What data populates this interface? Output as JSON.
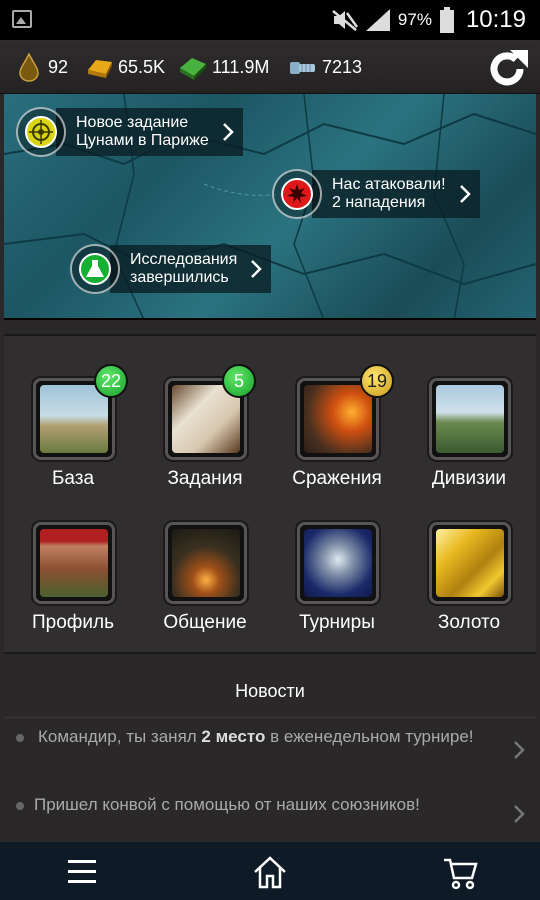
{
  "status_bar": {
    "battery": "97%",
    "time": "10:19"
  },
  "resources": [
    {
      "icon": "oil-drop-icon",
      "value": "92"
    },
    {
      "icon": "gold-bar-icon",
      "value": "65.5K"
    },
    {
      "icon": "money-stack-icon",
      "value": "111.9M"
    },
    {
      "icon": "bolt-icon",
      "value": "7213"
    }
  ],
  "notifications": [
    {
      "line1": "Новое задание",
      "line2": "Цунами в Париже",
      "icon": "target-icon",
      "color": "#d8d410"
    },
    {
      "line1": "Нас атаковали!",
      "line2": "2 нападения",
      "icon": "explosion-icon",
      "color": "#e01818"
    },
    {
      "line1": "Исследования",
      "line2": "завершились",
      "icon": "flask-icon",
      "color": "#18b030"
    }
  ],
  "menu": [
    {
      "label": "База",
      "badge": "22",
      "badge_color": "green",
      "icon": "base-icon"
    },
    {
      "label": "Задания",
      "badge": "5",
      "badge_color": "green",
      "icon": "missions-map-icon"
    },
    {
      "label": "Сражения",
      "badge": "19",
      "badge_color": "gold",
      "icon": "battle-tank-icon"
    },
    {
      "label": "Дивизии",
      "badge": "",
      "badge_color": "",
      "icon": "divisions-tanks-icon"
    },
    {
      "label": "Профиль",
      "badge": "",
      "badge_color": "",
      "icon": "soldier-portrait-icon"
    },
    {
      "label": "Общение",
      "badge": "",
      "badge_color": "",
      "icon": "campfire-icon"
    },
    {
      "label": "Турниры",
      "badge": "",
      "badge_color": "",
      "icon": "trophy-icon"
    },
    {
      "label": "Золото",
      "badge": "",
      "badge_color": "",
      "icon": "gold-bars-icon"
    }
  ],
  "news": {
    "title": "Новости",
    "items": [
      {
        "pre": "Командир, ты занял ",
        "bold": "2 место",
        "post": " в еженедельном турнире!"
      },
      {
        "pre": "Пришел конвой с помощью от наших союзников!",
        "bold": "",
        "post": ""
      }
    ]
  },
  "colors": {
    "accent_green": "#1a9e2a",
    "accent_gold": "#c99a16",
    "nav_bg": "#0e1a26"
  }
}
